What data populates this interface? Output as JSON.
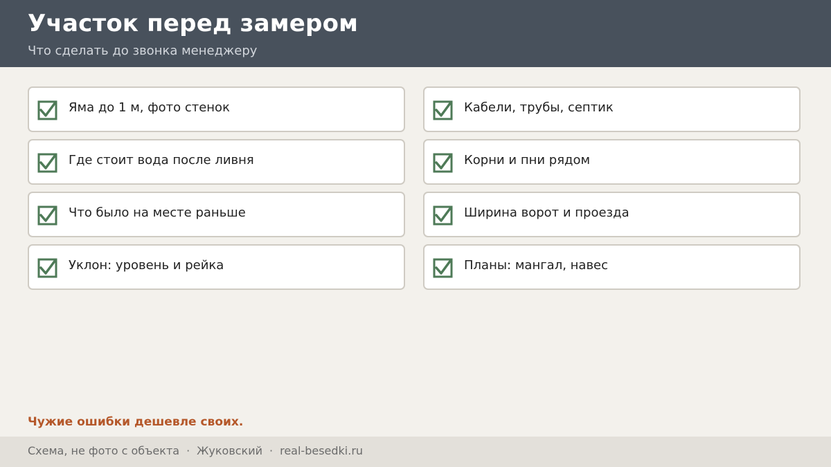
{
  "header": {
    "title": "Участок перед замером",
    "subtitle": "Что сделать до звонка менеджеру"
  },
  "checklist": {
    "items": [
      {
        "label": "Яма до 1 м, фото стенок",
        "checked": true
      },
      {
        "label": "Кабели, трубы, септик",
        "checked": true
      },
      {
        "label": "Где стоит вода после ливня",
        "checked": true
      },
      {
        "label": "Корни и пни рядом",
        "checked": true
      },
      {
        "label": "Что было на месте раньше",
        "checked": true
      },
      {
        "label": "Ширина ворот и проезда",
        "checked": true
      },
      {
        "label": "Уклон: уровень и рейка",
        "checked": true
      },
      {
        "label": "Планы: мангал, навес",
        "checked": true
      }
    ],
    "check_icon": "checkbox-checked-icon",
    "check_color": "#4e7a57"
  },
  "note": "Чужие ошибки дешевле своих.",
  "footer": {
    "disclaimer": "Схема, не фото с объекта",
    "separator": "·",
    "city": "Жуковский",
    "site": "real-besedki.ru"
  },
  "colors": {
    "header_bg": "#48515c",
    "page_bg": "#f3f1ec",
    "accent": "#b5582a",
    "footer_bg": "#e3e0da"
  }
}
